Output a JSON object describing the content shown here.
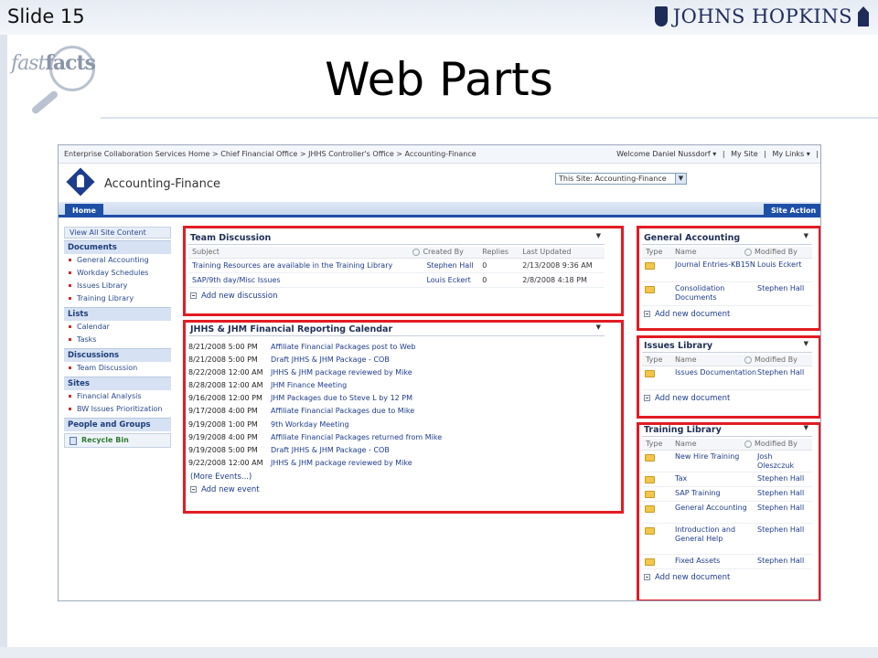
{
  "slide": {
    "number_label": "Slide 15",
    "brand": "JOHNS HOPKINS",
    "logo_text_fast": "fast",
    "logo_text_facts": "facts",
    "title": "Web Parts"
  },
  "sharepoint": {
    "breadcrumb": "Enterprise Collaboration Services Home > Chief Financial Office > JHHS Controller's Office > Accounting-Finance",
    "welcome": "Welcome Daniel Nussdorf ▾",
    "my_site": "My Site",
    "my_links": "My Links ▾",
    "site_title": "Accounting-Finance",
    "search_scope": "This Site: Accounting-Finance",
    "home_tab": "Home",
    "site_actions": "Site Action",
    "quicklaunch": {
      "view_all": "View All Site Content",
      "documents_head": "Documents",
      "documents": [
        "General Accounting",
        "Workday Schedules",
        "Issues Library",
        "Training Library"
      ],
      "lists_head": "Lists",
      "lists": [
        "Calendar",
        "Tasks"
      ],
      "discussions_head": "Discussions",
      "discussions": [
        "Team Discussion"
      ],
      "sites_head": "Sites",
      "sites": [
        "Financial Analysis",
        "BW Issues Prioritization"
      ],
      "people_head": "People and Groups",
      "recycle": "Recycle Bin"
    },
    "team_discussion": {
      "title": "Team Discussion",
      "headers": {
        "subject": "Subject",
        "created_by": "Created By",
        "replies": "Replies",
        "last_updated": "Last Updated"
      },
      "rows": [
        {
          "subject": "Training Resources are available in the Training Library",
          "created_by": "Stephen Hall",
          "replies": "0",
          "last_updated": "2/13/2008 9:36 AM"
        },
        {
          "subject": "SAP/9th day/Misc Issues",
          "created_by": "Louis Eckert",
          "replies": "0",
          "last_updated": "2/8/2008 4:18 PM"
        }
      ],
      "add_new": "Add new discussion"
    },
    "calendar": {
      "title": "JHHS & JHM Financial Reporting Calendar",
      "events": [
        {
          "date": "8/21/2008 5:00 PM",
          "title": "Affiliate Financial Packages post to Web"
        },
        {
          "date": "8/21/2008 5:00 PM",
          "title": "Draft JHHS & JHM Package - COB"
        },
        {
          "date": "8/22/2008 12:00 AM",
          "title": "JHHS & JHM package reviewed by Mike"
        },
        {
          "date": "8/28/2008 12:00 AM",
          "title": "JHM Finance Meeting"
        },
        {
          "date": "9/16/2008 12:00 PM",
          "title": "JHM Packages due to Steve L by 12 PM"
        },
        {
          "date": "9/17/2008 4:00 PM",
          "title": "Affiliate Financial Packages due to Mike"
        },
        {
          "date": "9/19/2008 1:00 PM",
          "title": "9th Workday Meeting"
        },
        {
          "date": "9/19/2008 4:00 PM",
          "title": "Affiliate Financial Packages returned from Mike"
        },
        {
          "date": "9/19/2008 5:00 PM",
          "title": "Draft JHHS & JHM Package - COB"
        },
        {
          "date": "9/22/2008 12:00 AM",
          "title": "JHHS & JHM package reviewed by Mike"
        }
      ],
      "more": "(More Events...)",
      "add_new": "Add new event"
    },
    "general_accounting": {
      "title": "General Accounting",
      "headers": {
        "type": "Type",
        "name": "Name",
        "modified_by": "Modified By"
      },
      "rows": [
        {
          "name": "Journal Entries-KB15N",
          "modified_by": "Louis Eckert"
        },
        {
          "name": "Consolidation Documents",
          "modified_by": "Stephen Hall"
        }
      ],
      "add_new": "Add new document"
    },
    "issues_library": {
      "title": "Issues Library",
      "headers": {
        "type": "Type",
        "name": "Name",
        "modified_by": "Modified By"
      },
      "rows": [
        {
          "name": "Issues Documentation",
          "modified_by": "Stephen Hall"
        }
      ],
      "add_new": "Add new document"
    },
    "training_library": {
      "title": "Training Library",
      "headers": {
        "type": "Type",
        "name": "Name",
        "modified_by": "Modified By"
      },
      "rows": [
        {
          "name": "New Hire Training",
          "modified_by": "Josh Oleszczuk"
        },
        {
          "name": "Tax",
          "modified_by": "Stephen Hall"
        },
        {
          "name": "SAP Training",
          "modified_by": "Stephen Hall"
        },
        {
          "name": "General Accounting",
          "modified_by": "Stephen Hall"
        },
        {
          "name": "Introduction and General Help",
          "modified_by": "Stephen Hall"
        },
        {
          "name": "Fixed Assets",
          "modified_by": "Stephen Hall"
        }
      ],
      "add_new": "Add new document"
    },
    "colors": {
      "accent": "#1d4fa6",
      "highlight": "#e21c24",
      "link": "#1e3c8c"
    }
  }
}
